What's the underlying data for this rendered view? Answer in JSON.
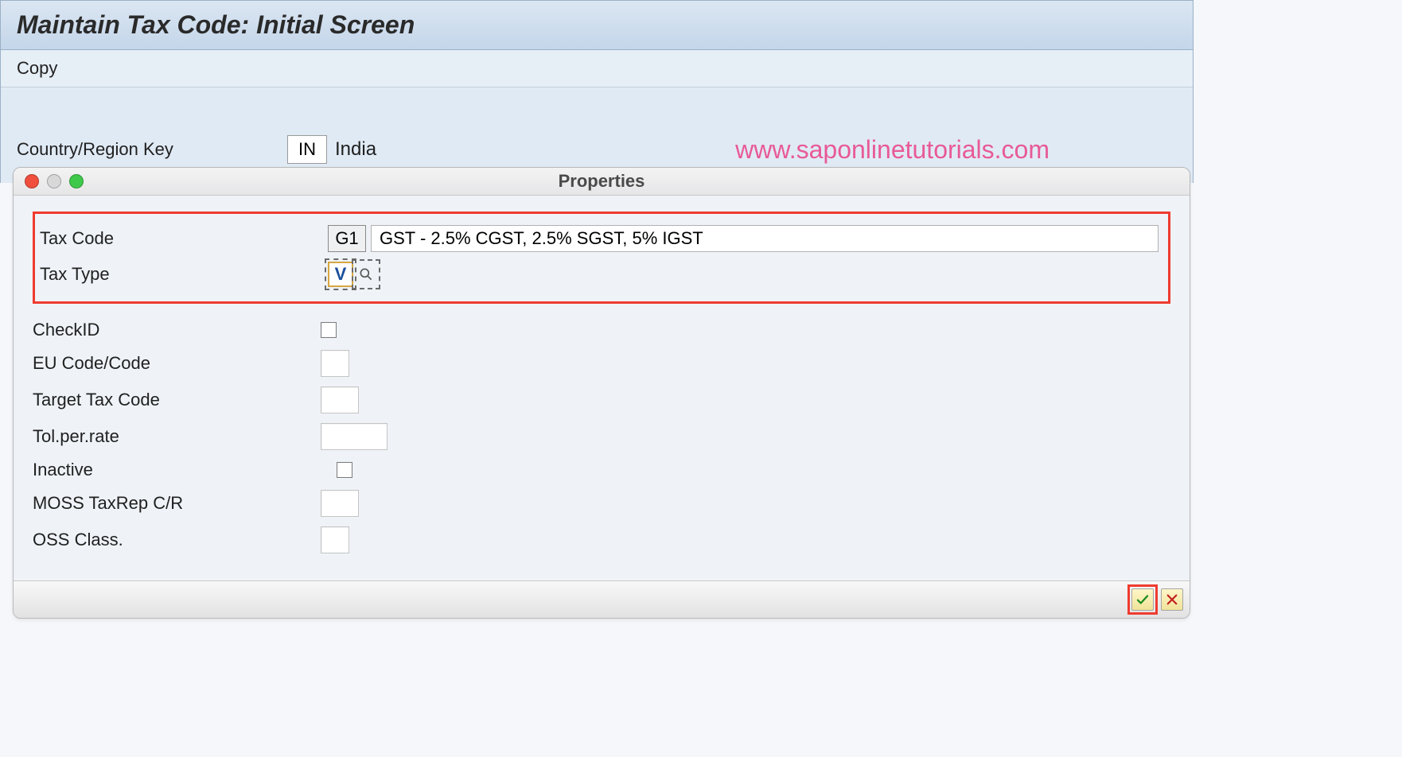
{
  "window": {
    "title": "Maintain Tax Code: Initial Screen",
    "menu": {
      "copy": "Copy"
    }
  },
  "main": {
    "country_label": "Country/Region Key",
    "country_code": "IN",
    "country_name": "India"
  },
  "watermark": "www.saponlinetutorials.com",
  "dialog": {
    "title": "Properties",
    "fields": {
      "tax_code": {
        "label": "Tax Code",
        "code": "G1",
        "desc": "GST - 2.5% CGST, 2.5% SGST, 5% IGST"
      },
      "tax_type": {
        "label": "Tax Type",
        "value": "V"
      },
      "check_id": {
        "label": "CheckID"
      },
      "eu_code": {
        "label": "EU Code/Code"
      },
      "target_tax": {
        "label": "Target Tax Code"
      },
      "tol_rate": {
        "label": "Tol.per.rate"
      },
      "inactive": {
        "label": "Inactive"
      },
      "moss": {
        "label": "MOSS TaxRep C/R"
      },
      "oss": {
        "label": "OSS Class."
      }
    }
  }
}
